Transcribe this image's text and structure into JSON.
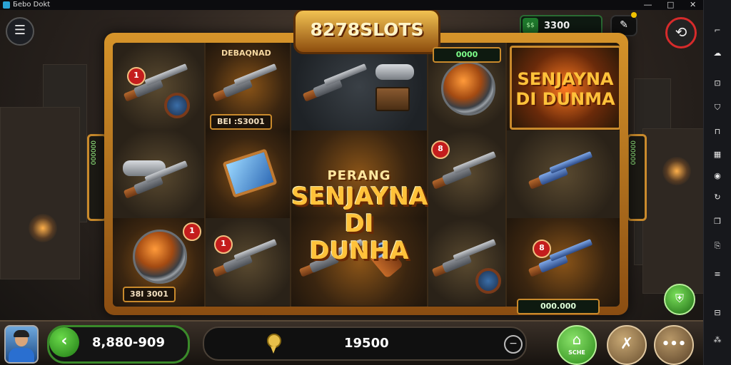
{
  "window": {
    "app_title": "Бebo Dokt",
    "controls": [
      "―",
      "□",
      "✕"
    ]
  },
  "header": {
    "menu_icon": "menu-icon",
    "logo": "8278SLOTS",
    "coins": "3300",
    "coin_icon_label": "$$",
    "edit_icon": "pencil-icon",
    "refresh_icon": "refresh-icon"
  },
  "reels": {
    "top_plaque": "0000",
    "bottom_plaque": "000.000",
    "left_tab": "000000",
    "right_tab": "000000",
    "center_small": "PERANG",
    "center_big_line1": "SENJAYNA",
    "center_big_line2": "DI DUNHA",
    "corner_line1": "SENJAYNA",
    "corner_line2": "DI DUNMA",
    "cells": {
      "r1_badge": "1",
      "r2_label": "DEBAQNAD",
      "r2_plaque": "BEI :S3001",
      "r3_badge": "1",
      "r3_plaque": "38I 3001",
      "r4_badge": "1",
      "r5_badge": "8",
      "r6_badge": "8"
    }
  },
  "footer": {
    "balance": "8,880-909",
    "bet": "19500",
    "home_label": "SCHE",
    "more_label": "•••"
  },
  "sidebar_icons": [
    "bracket-icon",
    "cloud-icon",
    "lock-icon",
    "shield-icon",
    "cart-icon",
    "grid-icon",
    "record-icon",
    "refresh-icon",
    "copy-icon",
    "pages-icon",
    "menu-icon",
    "box-icon"
  ],
  "colors": {
    "frame_gold": "#d6942a",
    "accent_red": "#d62b2b",
    "accent_green": "#3a8a2a"
  }
}
